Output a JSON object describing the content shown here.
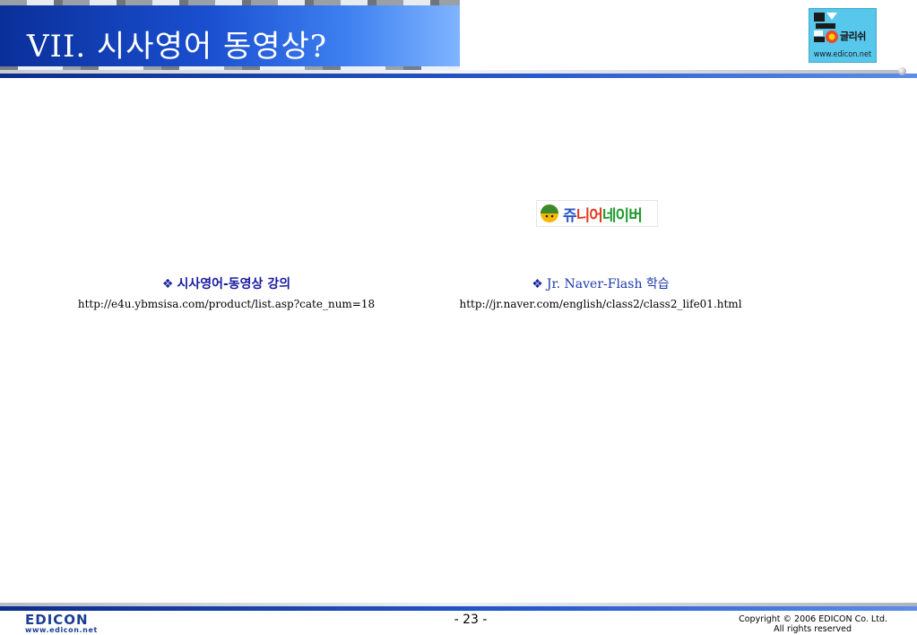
{
  "header": {
    "title": "VII. 시사영어 동영상?"
  },
  "logo": {
    "text": "글리쉬",
    "url": "www.edicon.net"
  },
  "content": {
    "naver_logo": {
      "part1": "쥬",
      "part2": "니어",
      "part3": "네이버"
    },
    "left": {
      "bullet": "❖",
      "title": "시사영어-동영상 강의",
      "url": "http://e4u.ybmsisa.com/product/list.asp?cate_num=18"
    },
    "right": {
      "bullet": "❖",
      "title": "Jr. Naver-Flash 학습",
      "url": "http://jr.naver.com/english/class2/class2_life01.html"
    }
  },
  "footer": {
    "brand": "EDICON",
    "brand_url": "www.edicon.net",
    "page_number": "- 23 -",
    "copyright_line1": "Copyright © 2006 EDICON Co. Ltd.",
    "copyright_line2": "All rights reserved"
  },
  "colors": {
    "title_band": "#1a4fd0",
    "rule_blue": "#0b2d8c",
    "logo_bg": "#57c7ec",
    "caption_blue": "#1a1aa0"
  }
}
